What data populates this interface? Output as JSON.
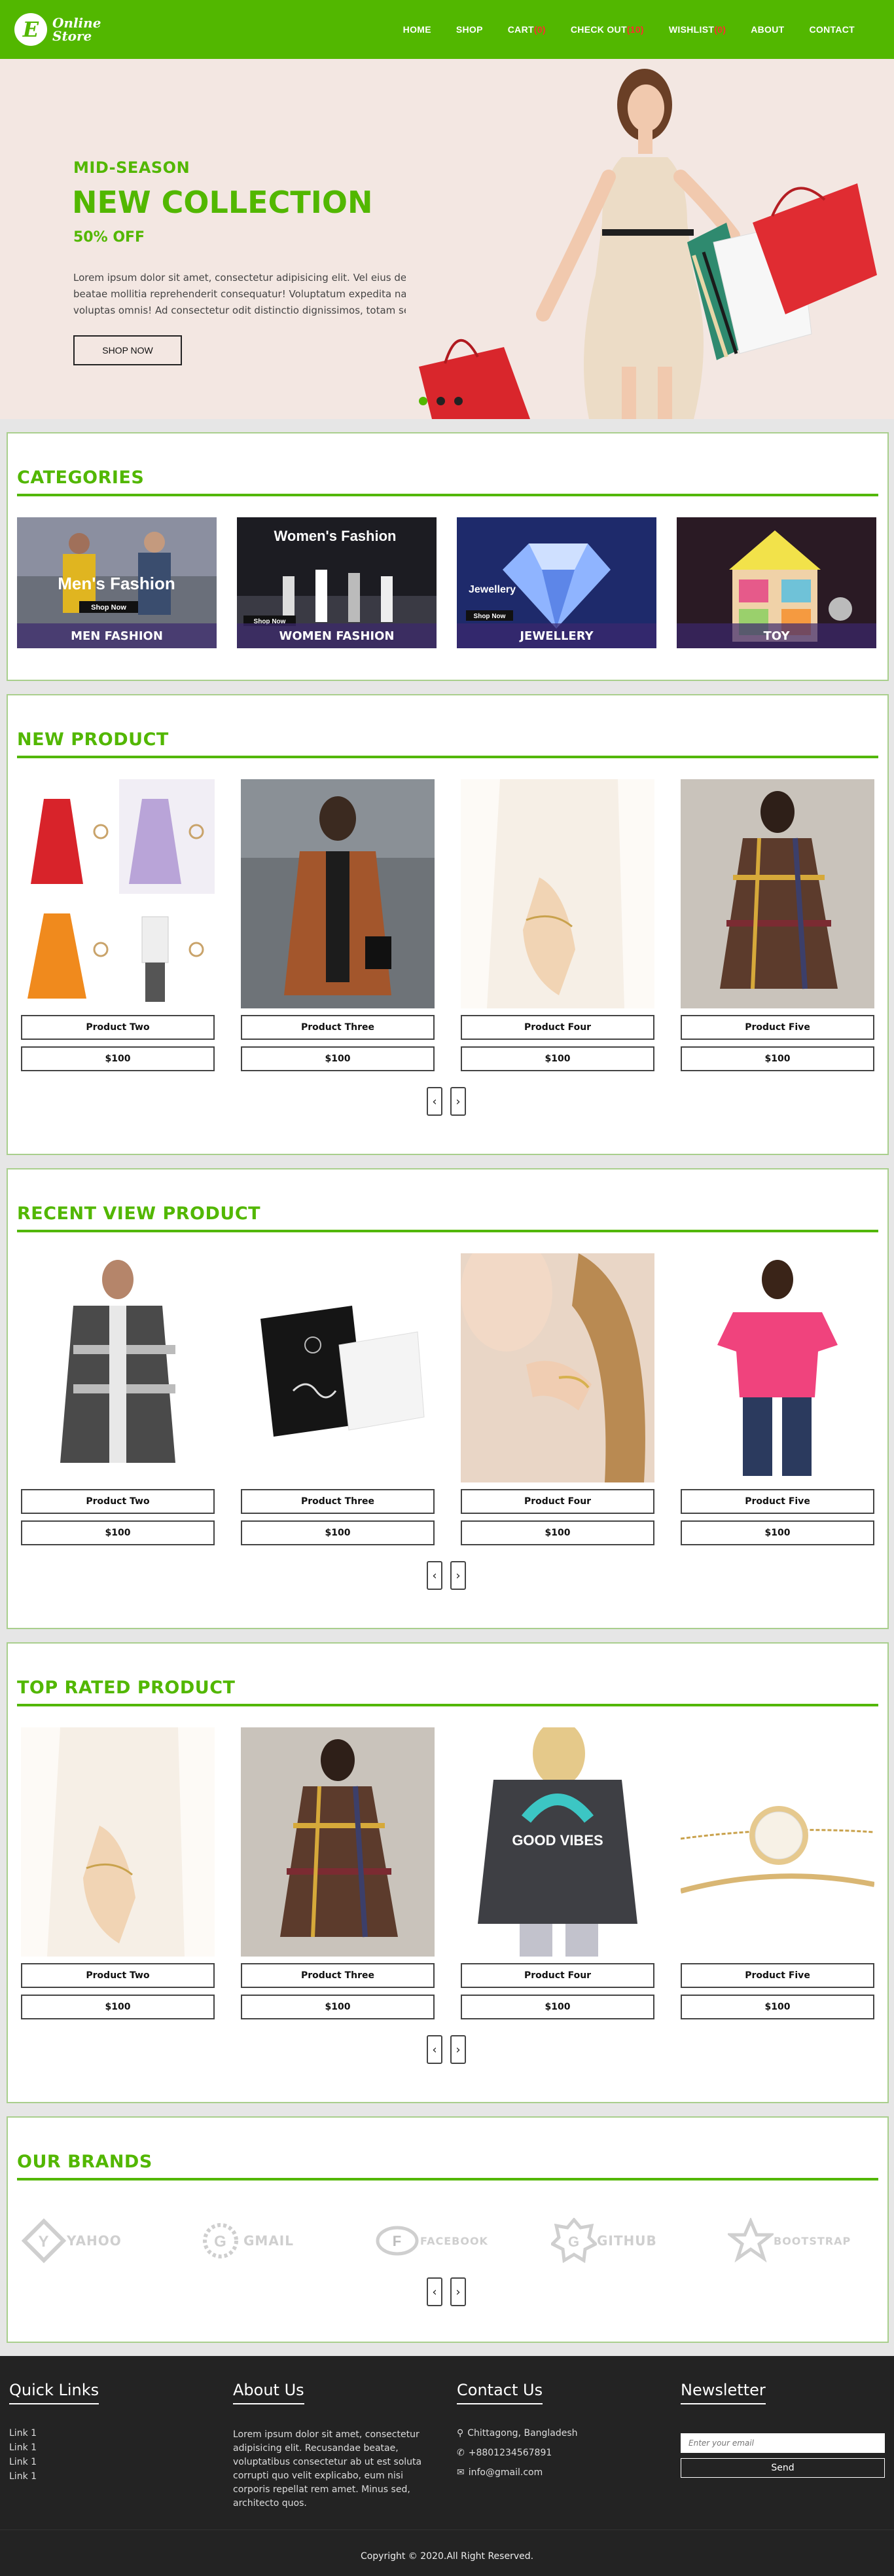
{
  "header": {
    "logo_initial": "E",
    "logo_line1": "Online",
    "logo_line2": "Store",
    "nav": {
      "home": "HOME",
      "shop": "SHOP",
      "cart": "CART",
      "cart_count": "(0)",
      "checkout": "CHECK OUT",
      "checkout_count": "(10)",
      "wishlist": "WISHLIST",
      "wishlist_count": "(0)",
      "about": "ABOUT",
      "contact": "CONTACT"
    }
  },
  "hero": {
    "subtitle": "MID-SEASON",
    "title": "NEW COLLECTION",
    "offer": "50% OFF",
    "text": "Lorem ipsum dolor sit amet, consectetur adipisicing elit. Vel eius deleniti, beatae mollitia reprehenderit consequatur! Voluptatum expedita natus voluptas omnis! Ad consectetur odit distinctio dignissimos, totam sed.",
    "button": "SHOP NOW",
    "slides": 3,
    "active_slide": 1
  },
  "categories": {
    "title": "CATEGORIES",
    "items": [
      {
        "label": "MEN FASHION",
        "overlay": "Men's Fashion",
        "shop_now": "Shop Now"
      },
      {
        "label": "WOMEN FASHION",
        "overlay": "Women's Fashion",
        "shop_now": "Shop Now"
      },
      {
        "label": "JEWELLERY",
        "overlay": "Jewellery",
        "shop_now": "Shop Now"
      },
      {
        "label": "TOY",
        "overlay": "",
        "shop_now": ""
      }
    ]
  },
  "new_product": {
    "title": "NEW PRODUCT",
    "items": [
      {
        "name": "Product Two",
        "price": "$100"
      },
      {
        "name": "Product Three",
        "price": "$100"
      },
      {
        "name": "Product Four",
        "price": "$100"
      },
      {
        "name": "Product Five",
        "price": "$100"
      }
    ]
  },
  "recent_product": {
    "title": "RECENT VIEW PRODUCT",
    "items": [
      {
        "name": "Product Two",
        "price": "$100"
      },
      {
        "name": "Product Three",
        "price": "$100"
      },
      {
        "name": "Product Four",
        "price": "$100"
      },
      {
        "name": "Product Five",
        "price": "$100"
      }
    ]
  },
  "top_rated": {
    "title": "TOP RATED PRODUCT",
    "items": [
      {
        "name": "Product Two",
        "price": "$100"
      },
      {
        "name": "Product Three",
        "price": "$100"
      },
      {
        "name": "Product Four",
        "price": "$100"
      },
      {
        "name": "Product Five",
        "price": "$100"
      }
    ],
    "tshirt_print": "GOOD VIBES"
  },
  "brands": {
    "title": "OUR BRANDS",
    "items": [
      "YAHOO",
      "GMAIL",
      "FACEBOOK",
      "GITHUB",
      "BOOTSTRAP"
    ],
    "marks": [
      "Y",
      "G",
      "F",
      "G",
      ""
    ]
  },
  "arrows": {
    "prev": "‹",
    "next": "›"
  },
  "footer": {
    "quick_links": {
      "title": "Quick Links",
      "links": [
        "Link 1",
        "Link 1",
        "Link 1",
        "Link 1"
      ]
    },
    "about": {
      "title": "About Us",
      "text": "Lorem ipsum dolor sit amet, consectetur adipisicing elit. Recusandae beatae, voluptatibus consectetur ab ut est soluta corrupti quo velit explicabo, eum nisi corporis repellat rem amet. Minus sed, architecto quos."
    },
    "contact": {
      "title": "Contact Us",
      "address": "Chittagong, Bangladesh",
      "phone": "+8801234567891",
      "email": "info@gmail.com"
    },
    "newsletter": {
      "title": "Newsletter",
      "placeholder": "Enter your email",
      "button": "Send"
    },
    "copyright": "Copyright © 2020.All Right Reserved."
  },
  "colors": {
    "brand": "#52b700",
    "footer_bg": "#232323",
    "badge_red": "#ff2d2d"
  }
}
